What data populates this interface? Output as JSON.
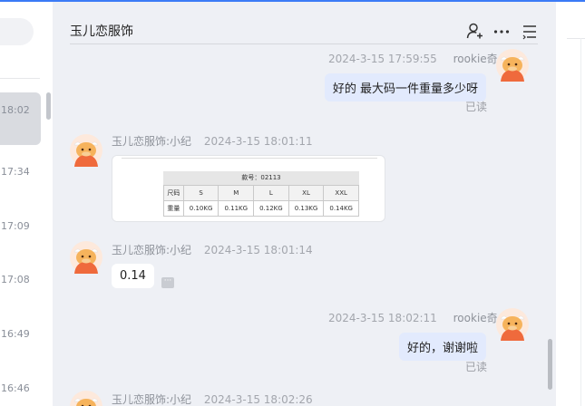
{
  "app": {
    "accent": "#3b7bf6"
  },
  "sidebar": {
    "times": [
      "18:02",
      "17:34",
      "17:09",
      "17:08",
      "16:49",
      "16:46"
    ]
  },
  "chat": {
    "title": "玉儿恋服饰",
    "header_icons": [
      "add-user-icon",
      "more-icon",
      "menu-icon"
    ],
    "messages": [
      {
        "side": "me",
        "name": "rookie奇",
        "time": "2024-3-15 17:59:55",
        "text": "好的 最大码一件重量多少呀",
        "status": "已读"
      },
      {
        "side": "them",
        "name": "玉儿恋服饰:小纪",
        "time": "2024-3-15 18:01:11",
        "type": "image"
      },
      {
        "side": "them",
        "name": "玉儿恋服饰:小纪",
        "time": "2024-3-15 18:01:14",
        "text": "0.14"
      },
      {
        "side": "me",
        "name": "rookie奇",
        "time": "2024-3-15 18:02:11",
        "text": "好的，谢谢啦",
        "status": "已读"
      },
      {
        "side": "them",
        "name": "玉儿恋服饰:小纪",
        "time": "2024-3-15 18:02:26"
      }
    ],
    "size_table": {
      "caption": "款号：02113",
      "header": [
        "尺码",
        "S",
        "M",
        "L",
        "XL",
        "XXL"
      ],
      "row": [
        "重量",
        "0.10KG",
        "0.11KG",
        "0.12KG",
        "0.13KG",
        "0.14KG"
      ]
    }
  }
}
